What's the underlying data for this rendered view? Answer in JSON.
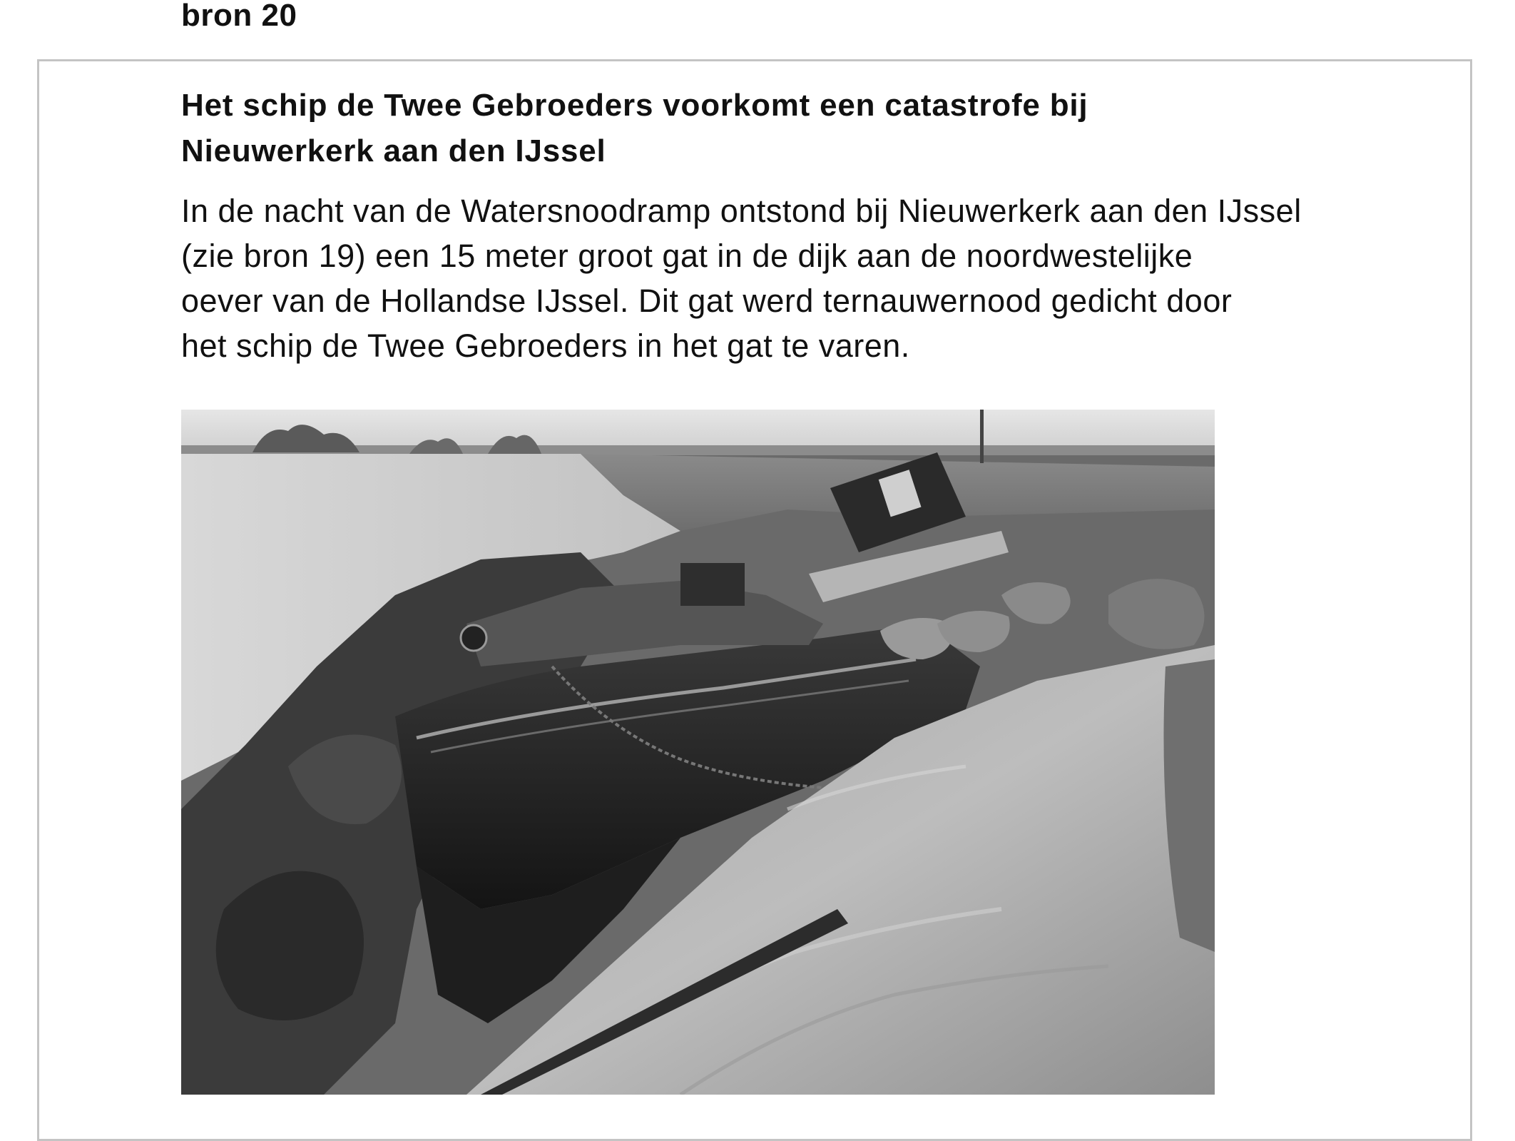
{
  "source": {
    "label": "bron 20",
    "title_lines": [
      "Het schip de Twee Gebroeders voorkomt een catastrofe bij",
      "Nieuwerkerk aan den IJssel"
    ],
    "text_lines": [
      "In de nacht van de Watersnoodramp ontstond bij Nieuwerkerk aan den IJssel",
      "(zie bron 19) een 15 meter groot gat in de dijk aan de noordwestelijke",
      "oever van de Hollandse IJssel. Dit gat werd ternauwernood gedicht door",
      "het schip de Twee Gebroeders in het gat te varen."
    ]
  },
  "colors": {
    "frame_border": "#c4c4c4",
    "text": "#111111"
  }
}
